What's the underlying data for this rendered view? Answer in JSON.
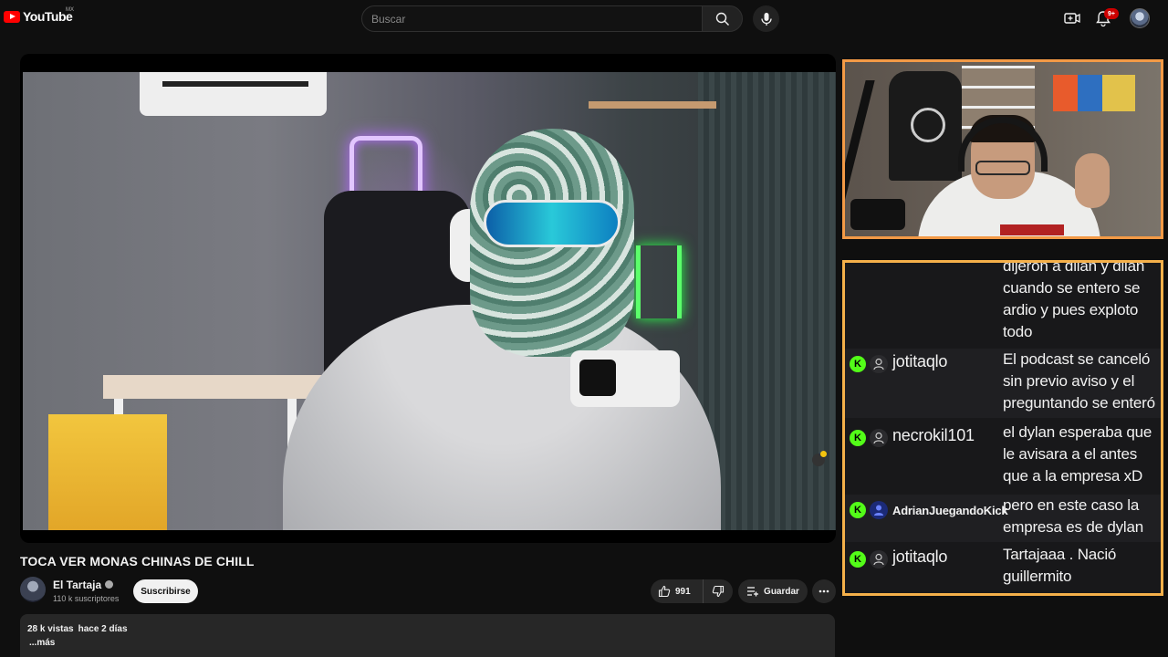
{
  "header": {
    "logo_text": "YouTube",
    "country_code": "MX",
    "search_placeholder": "Buscar",
    "notification_count": "9+",
    "icons": [
      "search-icon",
      "mic-icon",
      "create-video-icon",
      "bell-icon",
      "avatar"
    ]
  },
  "video": {
    "title": "TOCA VER MONAS CHINAS DE CHILL",
    "channel_name": "El Tartaja",
    "subscribers": "110 k suscriptores",
    "subscribe_label": "Suscribirse",
    "like_count": "991",
    "save_label": "Guardar",
    "views": "28 k vistas",
    "date": "hace 2 días",
    "more_label": "...más"
  },
  "chat": {
    "messages": [
      {
        "user": "",
        "text": "dijeron a dilan y dilan cuando se entero se ardio y pues exploto todo"
      },
      {
        "user": "jotitaqlo",
        "text": "El podcast se canceló sin previo aviso y el preguntando se enteró"
      },
      {
        "user": "necrokil101",
        "text": "el dylan esperaba que le avisara a el antes que a la empresa xD"
      },
      {
        "user": "AdrianJuegandoKick",
        "text": "pero en este caso la empresa es de dylan"
      },
      {
        "user": "jotitaqlo",
        "text": "Tartajaaa . Nació guillermito"
      }
    ],
    "badge_letter": "K"
  },
  "colors": {
    "youtube_red": "#ff0000",
    "kick_green": "#53fc18",
    "webcam_border": "#f39a46",
    "chat_border": "#f4b04a",
    "background": "#0f0f0f"
  }
}
